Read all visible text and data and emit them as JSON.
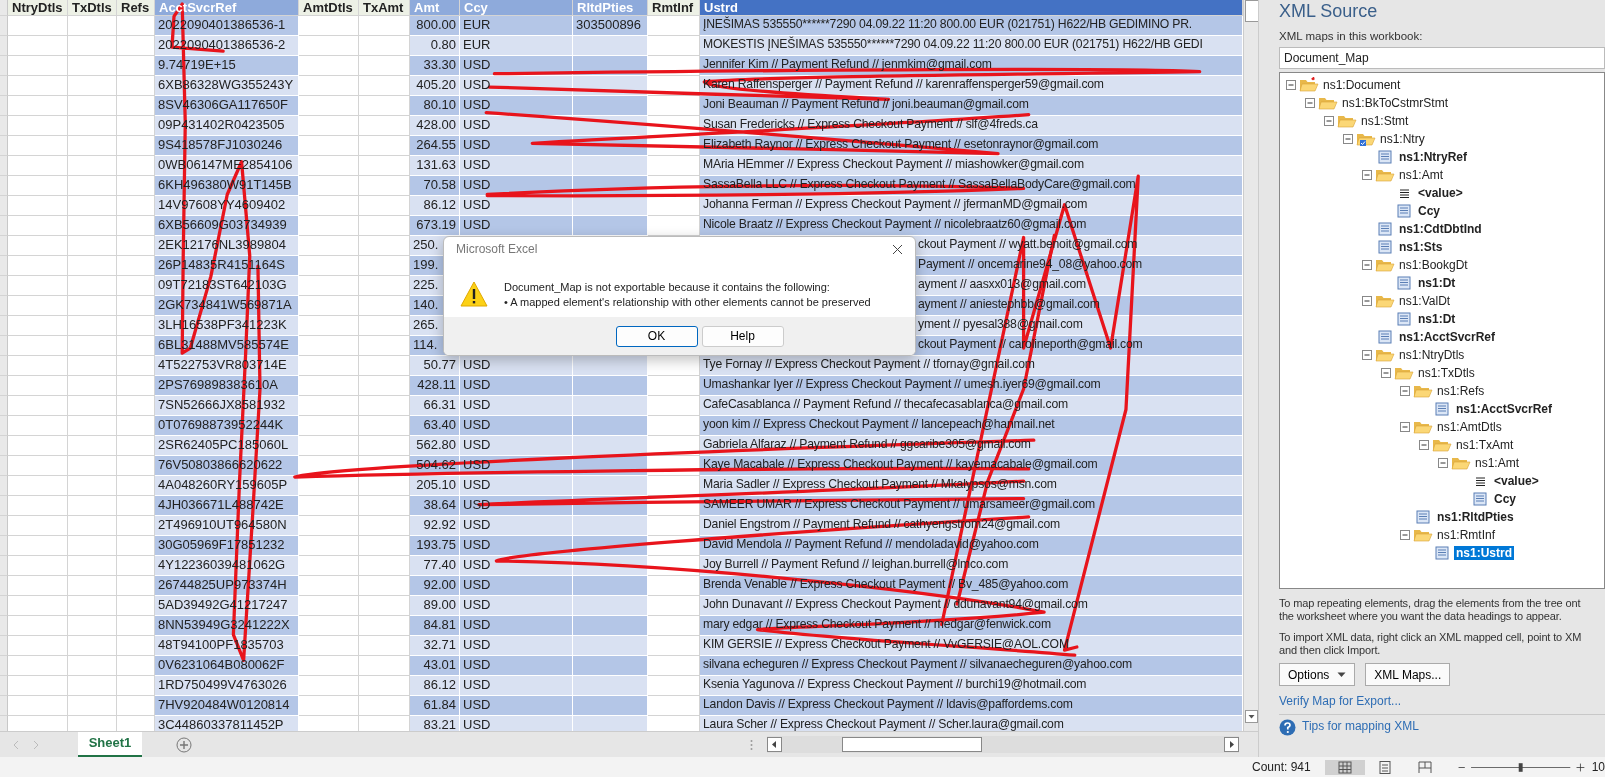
{
  "columns": [
    {
      "label": "NtryDtls",
      "kind": "plain",
      "selected": false
    },
    {
      "label": "TxDtls",
      "kind": "plain",
      "selected": false
    },
    {
      "label": "Refs",
      "kind": "plain",
      "selected": false
    },
    {
      "label": "AcctSvcrRef",
      "kind": "mapped",
      "selected": false
    },
    {
      "label": "AmtDtls",
      "kind": "plain",
      "selected": false
    },
    {
      "label": "TxAmt",
      "kind": "plain",
      "selected": false
    },
    {
      "label": "Amt",
      "kind": "mapped",
      "selected": false
    },
    {
      "label": "Ccy",
      "kind": "mapped",
      "selected": false
    },
    {
      "label": "RltdPties",
      "kind": "mapped",
      "selected": false
    },
    {
      "label": "RmtInf",
      "kind": "plain",
      "selected": false
    },
    {
      "label": "Ustrd",
      "kind": "mapped",
      "selected": true
    }
  ],
  "rows": [
    {
      "ref": "2022090401386536-1",
      "amt": "800.00",
      "ccy": "EUR",
      "rltd": "303500896",
      "ustrd": "ĮNEŠIMAS 535550******7290 04.09.22 11:20 800.00 EUR (021751) H622/HB GEDIMINO PR.",
      "covered": false
    },
    {
      "ref": "2022090401386536-2",
      "amt": "0.80",
      "ccy": "EUR",
      "ustrd": "MOKESTIS ĮNEŠIMAS 535550******7290 04.09.22 11:20 800.00 EUR (021751) H622/HB GEDI",
      "covered": false
    },
    {
      "ref": "9.74719E+15",
      "amt": "33.30",
      "ccy": "USD",
      "ustrd": "Jennifer Kim // Payment Refund // jenmkim@gmail.com",
      "covered": false
    },
    {
      "ref": "6XB86328WG355243Y",
      "amt": "405.20",
      "ccy": "USD",
      "ustrd": "Karen Raffensperger // Payment Refund // karenraffensperger59@gmail.com",
      "covered": false
    },
    {
      "ref": "8SV46306GA117650F",
      "amt": "80.10",
      "ccy": "USD",
      "ustrd": "Joni Beauman // Payment Refund // joni.beauman@gmail.com",
      "covered": false
    },
    {
      "ref": "09P431402R0423505",
      "amt": "428.00",
      "ccy": "USD",
      "ustrd": "Susan Fredericks // Express Checkout Payment // slf@4freds.ca",
      "covered": false
    },
    {
      "ref": "9S418578FJ1030246",
      "amt": "264.55",
      "ccy": "USD",
      "ustrd": "Elizabeth Raynor // Express Checkout Payment // esetonraynor@gmail.com",
      "covered": false
    },
    {
      "ref": "0WB06147ME2854106",
      "amt": "131.63",
      "ccy": "USD",
      "ustrd": "MAria HEmmer // Express Checkout Payment // miashowker@gmail.com",
      "covered": false
    },
    {
      "ref": "6KH496380W91T145B",
      "amt": "70.58",
      "ccy": "USD",
      "ustrd": "SassaBella LLC // Express Checkout Payment // SassaBellaBodyCare@gmail.com",
      "covered": false
    },
    {
      "ref": "14V97608YY4609402",
      "amt": "86.12",
      "ccy": "USD",
      "ustrd": "Johanna Ferman // Express Checkout Payment // jfermanMD@gmail.com",
      "covered": false
    },
    {
      "ref": "6XB56609G03734939",
      "amt": "673.19",
      "ccy": "USD",
      "ustrd": "Nicole Braatz // Express Checkout Payment // nicolebraatz60@gmail.com",
      "covered": false
    },
    {
      "ref": "2EK12176NL3989804",
      "amt": "250.",
      "ustrd": "ckout Payment // wyatt.benoit@gmail.com",
      "covered": true
    },
    {
      "ref": "26P14835R4151164S",
      "amt": "199.",
      "ustrd": "Payment // oncemarine94_08@yahoo.com",
      "covered": true
    },
    {
      "ref": "09T72183ST642103G",
      "amt": "225.",
      "ustrd": "ayment // aasxx013@gmail.com",
      "covered": true
    },
    {
      "ref": "2GK734841W569871A",
      "amt": "140.",
      "ustrd": "ayment // aniestephbb@gmail.com",
      "covered": true
    },
    {
      "ref": "3LH16538PF341223K",
      "amt": "265.",
      "ustrd": "yment // pyesal388@gmail.com",
      "covered": true
    },
    {
      "ref": "6BL31488MV585574E",
      "amt": "114.",
      "ustrd": "ckout Payment // carolineporth@gmail.com",
      "covered": true
    },
    {
      "ref": "4T522753VR803714E",
      "amt": "50.77",
      "ccy": "USD",
      "ustrd": "Tye Fornay // Express Checkout Payment // tfornay@gmail.com",
      "covered": false
    },
    {
      "ref": "2PS769898383610A",
      "amt": "428.11",
      "ccy": "USD",
      "ustrd": "Umashankar Iyer // Express Checkout Payment // umesh.iyer69@gmail.com",
      "covered": false
    },
    {
      "ref": "7SN52666JX8581932",
      "amt": "66.31",
      "ccy": "USD",
      "ustrd": "CafeCasablanca // Payment Refund // thecafecasablanca@gmail.com",
      "covered": false
    },
    {
      "ref": "0T07698873952244K",
      "amt": "63.40",
      "ccy": "USD",
      "ustrd": "yoon kim // Express Checkout Payment // lancepeach@hanmail.net",
      "covered": false
    },
    {
      "ref": "2SR62405PC185060L",
      "amt": "562.80",
      "ccy": "USD",
      "ustrd": "Gabriela Alfaraz // Payment Refund // ggcaribe305@gmail.com",
      "covered": false
    },
    {
      "ref": "76V50803866620622",
      "amt": "504.62",
      "ccy": "USD",
      "ustrd": "Kaye Macabale // Express Checkout Payment // kayemacabale@gmail.com",
      "covered": false
    },
    {
      "ref": "4A048260RY159605P",
      "amt": "205.10",
      "ccy": "USD",
      "ustrd": "Maria Sadler // Express Checkout Payment // Mkalypsos@msn.com",
      "covered": false
    },
    {
      "ref": "4JH036671L488742E",
      "amt": "38.64",
      "ccy": "USD",
      "ustrd": "SAMEER UMAR // Express Checkout Payment // umarsameer@gmail.com",
      "covered": false
    },
    {
      "ref": "2T496910UT964580N",
      "amt": "92.92",
      "ccy": "USD",
      "ustrd": "Daniel Engstrom // Payment Refund // cathyengstrom24@gmail.com",
      "covered": false
    },
    {
      "ref": "30G05969F17851232",
      "amt": "193.75",
      "ccy": "USD",
      "ustrd": "David Mendola // Payment Refund // mendoladavid@yahoo.com",
      "covered": false
    },
    {
      "ref": "4Y12236039481062G",
      "amt": "77.40",
      "ccy": "USD",
      "ustrd": "Joy Burrell // Payment Refund // leighan.burrell@lmco.com",
      "covered": false
    },
    {
      "ref": "26744825UP973374H",
      "amt": "92.00",
      "ccy": "USD",
      "ustrd": "Brenda Venable // Express Checkout Payment // Bv_485@yahoo.com",
      "covered": false
    },
    {
      "ref": "5AD39492G41217247",
      "amt": "89.00",
      "ccy": "USD",
      "ustrd": "John Dunavant // Express Checkout Payment // ddunavant94@gmail.com",
      "covered": false
    },
    {
      "ref": "8NN53949G3241222X",
      "amt": "84.81",
      "ccy": "USD",
      "ustrd": "mary edgar // Express Checkout Payment // medgar@fenwick.com",
      "covered": false
    },
    {
      "ref": "48T94100PF1835703",
      "amt": "32.71",
      "ccy": "USD",
      "ustrd": "KIM GERSIE // Express Checkout Payment // VvGERSIE@AOL.COM",
      "covered": false
    },
    {
      "ref": "0V6231064B080062F",
      "amt": "43.01",
      "ccy": "USD",
      "ustrd": "silvana echeguren // Express Checkout Payment // silvanaecheguren@yahoo.com",
      "covered": false
    },
    {
      "ref": "1RD750499V4763026",
      "amt": "86.12",
      "ccy": "USD",
      "ustrd": "Ksenia Yagunova // Express Checkout Payment // burchi19@hotmail.com",
      "covered": false
    },
    {
      "ref": "7HV920484W0120814",
      "amt": "61.84",
      "ccy": "USD",
      "ustrd": "Landon Davis // Express Checkout Payment // ldavis@paffordems.com",
      "covered": false
    },
    {
      "ref": "3C44860337811452P",
      "amt": "83.21",
      "ccy": "USD",
      "ustrd": "Laura Scher // Express Checkout Payment // Scher.laura@gmail.com",
      "covered": false
    }
  ],
  "sheet_tabs": [
    {
      "label": "Sheet1",
      "selected": true
    }
  ],
  "dialog": {
    "title": "Microsoft Excel",
    "message": "Document_Map is not exportable because it contains the following:",
    "bullet": "• A mapped element's relationship with other elements cannot be preserved",
    "buttons": [
      {
        "label": "OK",
        "selected": true
      },
      {
        "label": "Help",
        "selected": false
      }
    ]
  },
  "xml_pane": {
    "title": "XML Source",
    "maps_label": "XML maps in this workbook:",
    "map": "Document_Map",
    "tree": [
      {
        "label": "ns1:Document",
        "kind": "root",
        "mapped": false,
        "selected": false,
        "children": [
          {
            "label": "ns1:BkToCstmrStmt",
            "kind": "folder",
            "mapped": false,
            "selected": false,
            "children": [
              {
                "label": "ns1:Stmt",
                "kind": "folder",
                "mapped": false,
                "selected": false,
                "children": [
                  {
                    "label": "ns1:Ntry",
                    "kind": "repeat",
                    "mapped": false,
                    "selected": false,
                    "children": [
                      {
                        "label": "ns1:NtryRef",
                        "kind": "element",
                        "mapped": true,
                        "selected": false
                      },
                      {
                        "label": "ns1:Amt",
                        "kind": "folder",
                        "mapped": false,
                        "selected": false,
                        "children": [
                          {
                            "label": "<value>",
                            "kind": "value",
                            "mapped": true,
                            "selected": false
                          },
                          {
                            "label": "Ccy",
                            "kind": "element",
                            "mapped": true,
                            "selected": false
                          }
                        ]
                      },
                      {
                        "label": "ns1:CdtDbtInd",
                        "kind": "element",
                        "mapped": true,
                        "selected": false
                      },
                      {
                        "label": "ns1:Sts",
                        "kind": "element",
                        "mapped": true,
                        "selected": false
                      },
                      {
                        "label": "ns1:BookgDt",
                        "kind": "folder",
                        "mapped": false,
                        "selected": false,
                        "children": [
                          {
                            "label": "ns1:Dt",
                            "kind": "element",
                            "mapped": true,
                            "selected": false
                          }
                        ]
                      },
                      {
                        "label": "ns1:ValDt",
                        "kind": "folder",
                        "mapped": false,
                        "selected": false,
                        "children": [
                          {
                            "label": "ns1:Dt",
                            "kind": "element",
                            "mapped": true,
                            "selected": false
                          }
                        ]
                      },
                      {
                        "label": "ns1:AcctSvcrRef",
                        "kind": "element",
                        "mapped": true,
                        "selected": false
                      },
                      {
                        "label": "ns1:NtryDtls",
                        "kind": "folder",
                        "mapped": false,
                        "selected": false,
                        "children": [
                          {
                            "label": "ns1:TxDtls",
                            "kind": "folder",
                            "mapped": false,
                            "selected": false,
                            "children": [
                              {
                                "label": "ns1:Refs",
                                "kind": "folder",
                                "mapped": false,
                                "selected": false,
                                "children": [
                                  {
                                    "label": "ns1:AcctSvcrRef",
                                    "kind": "element",
                                    "mapped": true,
                                    "selected": false
                                  }
                                ]
                              },
                              {
                                "label": "ns1:AmtDtls",
                                "kind": "folder",
                                "mapped": false,
                                "selected": false,
                                "children": [
                                  {
                                    "label": "ns1:TxAmt",
                                    "kind": "folder",
                                    "mapped": false,
                                    "selected": false,
                                    "children": [
                                      {
                                        "label": "ns1:Amt",
                                        "kind": "folder",
                                        "mapped": false,
                                        "selected": false,
                                        "children": [
                                          {
                                            "label": "<value>",
                                            "kind": "value",
                                            "mapped": true,
                                            "selected": false
                                          },
                                          {
                                            "label": "Ccy",
                                            "kind": "element",
                                            "mapped": true,
                                            "selected": false
                                          }
                                        ]
                                      }
                                    ]
                                  }
                                ]
                              },
                              {
                                "label": "ns1:RltdPties",
                                "kind": "element",
                                "mapped": true,
                                "selected": false
                              },
                              {
                                "label": "ns1:RmtInf",
                                "kind": "folder",
                                "mapped": false,
                                "selected": false,
                                "children": [
                                  {
                                    "label": "ns1:Ustrd",
                                    "kind": "element",
                                    "mapped": true,
                                    "selected": true
                                  }
                                ]
                              }
                            ]
                          }
                        ]
                      }
                    ]
                  }
                ]
              }
            ]
          }
        ]
      }
    ],
    "hint_1": [
      "To map repeating elements, drag the elements from the tree ont",
      "the worksheet where you want the data headings to appear."
    ],
    "hint_2": [
      "To import XML data, right click an XML mapped cell, point to XM",
      "and then click Import."
    ],
    "options_button": "Options",
    "maps_button": "XML Maps...",
    "verify_link": "Verify Map for Export...",
    "tips_link": "Tips for mapping XML"
  },
  "status_bar": {
    "count": "Count: 941",
    "level": 0.5,
    "zoom": "10"
  }
}
